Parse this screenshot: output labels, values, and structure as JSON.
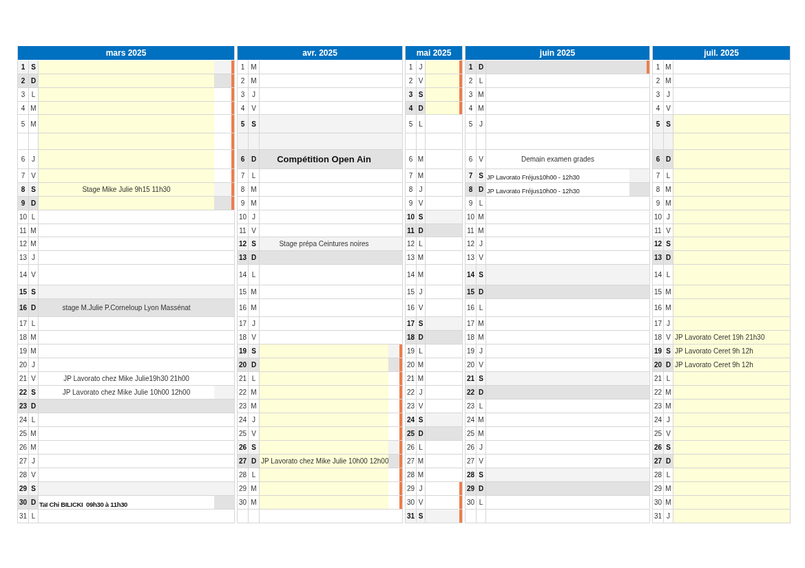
{
  "months": [
    {
      "title": "mars 2025",
      "days": [
        {
          "day": "1",
          "weekday": "S",
          "kind": "saturday",
          "highlighted": true,
          "cleared": false,
          "vacation": true
        },
        {
          "day": "2",
          "weekday": "D",
          "kind": "sunday",
          "highlighted": true,
          "cleared": false,
          "vacation": true
        },
        {
          "day": "3",
          "weekday": "L",
          "kind": "weekday",
          "highlighted": true,
          "vacation": true
        },
        {
          "day": "4",
          "weekday": "M",
          "kind": "weekday",
          "highlighted": true,
          "vacation": true
        },
        {
          "day": "5",
          "weekday": "M",
          "kind": "weekday",
          "highlighted": true,
          "vacation": true
        },
        {
          "day": "6",
          "weekday": "J",
          "kind": "weekday",
          "highlighted": true,
          "vacation": true
        },
        {
          "day": "7",
          "weekday": "V",
          "kind": "weekday",
          "highlighted": true,
          "vacation": true
        },
        {
          "day": "8",
          "weekday": "S",
          "kind": "saturday",
          "highlighted": true,
          "cleared": false,
          "vacation": true,
          "event": {
            "text": "Stage Mike Julie 9h15 11h30",
            "kind": "centered"
          }
        },
        {
          "day": "9",
          "weekday": "D",
          "kind": "sunday",
          "highlighted": true,
          "cleared": false,
          "vacation": true
        },
        {
          "day": "10",
          "weekday": "L",
          "kind": "weekday",
          "highlighted": false,
          "vacation": false
        },
        {
          "day": "11",
          "weekday": "M",
          "kind": "weekday",
          "highlighted": false,
          "vacation": false
        },
        {
          "day": "12",
          "weekday": "M",
          "kind": "weekday",
          "highlighted": false,
          "vacation": false
        },
        {
          "day": "13",
          "weekday": "J",
          "kind": "weekday",
          "highlighted": false,
          "vacation": false
        },
        {
          "day": "14",
          "weekday": "V",
          "kind": "weekday",
          "highlighted": false,
          "vacation": false
        },
        {
          "day": "15",
          "weekday": "S",
          "kind": "saturday",
          "highlighted": false,
          "cleared": false,
          "vacation": false
        },
        {
          "day": "16",
          "weekday": "D",
          "kind": "sunday",
          "highlighted": false,
          "cleared": false,
          "vacation": false,
          "event": {
            "text": "stage M.Julie P.Corneloup Lyon Massénat",
            "kind": "centered"
          }
        },
        {
          "day": "17",
          "weekday": "L",
          "kind": "weekday",
          "highlighted": false,
          "vacation": false
        },
        {
          "day": "18",
          "weekday": "M",
          "kind": "weekday",
          "highlighted": false,
          "vacation": false
        },
        {
          "day": "19",
          "weekday": "M",
          "kind": "weekday",
          "highlighted": false,
          "vacation": false
        },
        {
          "day": "20",
          "weekday": "J",
          "kind": "weekday",
          "highlighted": false,
          "vacation": false
        },
        {
          "day": "21",
          "weekday": "V",
          "kind": "weekday",
          "highlighted": false,
          "vacation": false,
          "event": {
            "text": "JP Lavorato chez Mike Julie19h30 21h00",
            "kind": "centered"
          }
        },
        {
          "day": "22",
          "weekday": "S",
          "kind": "saturday",
          "highlighted": false,
          "cleared": true,
          "vacation": false,
          "event": {
            "text": "JP Lavorato chez Mike Julie 10h00 12h00",
            "kind": "centered"
          }
        },
        {
          "day": "23",
          "weekday": "D",
          "kind": "sunday",
          "highlighted": false,
          "cleared": false,
          "vacation": false
        },
        {
          "day": "24",
          "weekday": "L",
          "kind": "weekday",
          "highlighted": false,
          "vacation": false
        },
        {
          "day": "25",
          "weekday": "M",
          "kind": "weekday",
          "highlighted": false,
          "vacation": false
        },
        {
          "day": "26",
          "weekday": "M",
          "kind": "weekday",
          "highlighted": false,
          "vacation": false
        },
        {
          "day": "27",
          "weekday": "J",
          "kind": "weekday",
          "highlighted": false,
          "vacation": false
        },
        {
          "day": "28",
          "weekday": "V",
          "kind": "weekday",
          "highlighted": false,
          "vacation": false
        },
        {
          "day": "29",
          "weekday": "S",
          "kind": "saturday",
          "highlighted": false,
          "cleared": false,
          "vacation": false
        },
        {
          "day": "30",
          "weekday": "D",
          "kind": "sunday",
          "highlighted": false,
          "cleared": true,
          "vacation": false,
          "event": {
            "text": "Taï Chi BILICKI  09h30 à 11h30",
            "kind": "note-bold"
          }
        },
        {
          "day": "31",
          "weekday": "L",
          "kind": "weekday",
          "highlighted": false,
          "vacation": false
        }
      ]
    },
    {
      "title": "avr. 2025",
      "days": [
        {
          "day": "1",
          "weekday": "M",
          "kind": "weekday",
          "highlighted": false,
          "vacation": false
        },
        {
          "day": "2",
          "weekday": "M",
          "kind": "weekday",
          "highlighted": false,
          "vacation": false
        },
        {
          "day": "3",
          "weekday": "J",
          "kind": "weekday",
          "highlighted": false,
          "vacation": false
        },
        {
          "day": "4",
          "weekday": "V",
          "kind": "weekday",
          "highlighted": false,
          "vacation": false
        },
        {
          "day": "5",
          "weekday": "S",
          "kind": "saturday",
          "highlighted": false,
          "cleared": false,
          "vacation": false
        },
        {
          "day": "6",
          "weekday": "D",
          "kind": "sunday",
          "highlighted": false,
          "cleared": false,
          "vacation": false,
          "event": {
            "text": "Compétition Open Ain",
            "kind": "headline"
          }
        },
        {
          "day": "7",
          "weekday": "L",
          "kind": "weekday",
          "highlighted": false,
          "vacation": false
        },
        {
          "day": "8",
          "weekday": "M",
          "kind": "weekday",
          "highlighted": false,
          "vacation": false
        },
        {
          "day": "9",
          "weekday": "M",
          "kind": "weekday",
          "highlighted": false,
          "vacation": false
        },
        {
          "day": "10",
          "weekday": "J",
          "kind": "weekday",
          "highlighted": false,
          "vacation": false
        },
        {
          "day": "11",
          "weekday": "V",
          "kind": "weekday",
          "highlighted": false,
          "vacation": false
        },
        {
          "day": "12",
          "weekday": "S",
          "kind": "saturday",
          "highlighted": false,
          "cleared": false,
          "vacation": false,
          "event": {
            "text": "Stage prépa Ceintures noires",
            "kind": "centered"
          }
        },
        {
          "day": "13",
          "weekday": "D",
          "kind": "sunday",
          "highlighted": false,
          "cleared": false,
          "vacation": false
        },
        {
          "day": "14",
          "weekday": "L",
          "kind": "weekday",
          "highlighted": false,
          "vacation": false
        },
        {
          "day": "15",
          "weekday": "M",
          "kind": "weekday",
          "highlighted": false,
          "vacation": false
        },
        {
          "day": "16",
          "weekday": "M",
          "kind": "weekday",
          "highlighted": false,
          "vacation": false
        },
        {
          "day": "17",
          "weekday": "J",
          "kind": "weekday",
          "highlighted": false,
          "vacation": false
        },
        {
          "day": "18",
          "weekday": "V",
          "kind": "weekday",
          "highlighted": false,
          "vacation": false
        },
        {
          "day": "19",
          "weekday": "S",
          "kind": "saturday",
          "highlighted": true,
          "cleared": false,
          "vacation": true
        },
        {
          "day": "20",
          "weekday": "D",
          "kind": "sunday",
          "highlighted": true,
          "cleared": false,
          "vacation": true
        },
        {
          "day": "21",
          "weekday": "L",
          "kind": "weekday",
          "highlighted": true,
          "vacation": true
        },
        {
          "day": "22",
          "weekday": "M",
          "kind": "weekday",
          "highlighted": true,
          "vacation": true
        },
        {
          "day": "23",
          "weekday": "M",
          "kind": "weekday",
          "highlighted": true,
          "vacation": true
        },
        {
          "day": "24",
          "weekday": "J",
          "kind": "weekday",
          "highlighted": true,
          "vacation": true
        },
        {
          "day": "25",
          "weekday": "V",
          "kind": "weekday",
          "highlighted": true,
          "vacation": true
        },
        {
          "day": "26",
          "weekday": "S",
          "kind": "saturday",
          "highlighted": true,
          "cleared": false,
          "vacation": true
        },
        {
          "day": "27",
          "weekday": "D",
          "kind": "sunday",
          "highlighted": true,
          "cleared": false,
          "vacation": true,
          "event": {
            "text": "JP Lavorato chez Mike Julie 10h00 12h00",
            "kind": "left"
          }
        },
        {
          "day": "28",
          "weekday": "L",
          "kind": "weekday",
          "highlighted": true,
          "vacation": true
        },
        {
          "day": "29",
          "weekday": "M",
          "kind": "weekday",
          "highlighted": true,
          "vacation": true
        },
        {
          "day": "30",
          "weekday": "M",
          "kind": "weekday",
          "highlighted": true,
          "vacation": true
        }
      ]
    },
    {
      "title": "mai 2025",
      "days": [
        {
          "day": "1",
          "weekday": "J",
          "kind": "weekday",
          "highlighted": true,
          "vacation": true
        },
        {
          "day": "2",
          "weekday": "V",
          "kind": "weekday",
          "highlighted": true,
          "vacation": true
        },
        {
          "day": "3",
          "weekday": "S",
          "kind": "saturday",
          "highlighted": true,
          "cleared": false,
          "vacation": true
        },
        {
          "day": "4",
          "weekday": "D",
          "kind": "sunday",
          "highlighted": true,
          "cleared": false,
          "vacation": true
        },
        {
          "day": "5",
          "weekday": "L",
          "kind": "weekday",
          "highlighted": false,
          "vacation": false
        },
        {
          "day": "6",
          "weekday": "M",
          "kind": "weekday",
          "highlighted": false,
          "vacation": false
        },
        {
          "day": "7",
          "weekday": "M",
          "kind": "weekday",
          "highlighted": false,
          "vacation": false
        },
        {
          "day": "8",
          "weekday": "J",
          "kind": "weekday",
          "highlighted": false,
          "vacation": false
        },
        {
          "day": "9",
          "weekday": "V",
          "kind": "weekday",
          "highlighted": false,
          "vacation": false
        },
        {
          "day": "10",
          "weekday": "S",
          "kind": "saturday",
          "highlighted": false,
          "cleared": false,
          "vacation": false
        },
        {
          "day": "11",
          "weekday": "D",
          "kind": "sunday",
          "highlighted": false,
          "cleared": false,
          "vacation": false
        },
        {
          "day": "12",
          "weekday": "L",
          "kind": "weekday",
          "highlighted": false,
          "vacation": false
        },
        {
          "day": "13",
          "weekday": "M",
          "kind": "weekday",
          "highlighted": false,
          "vacation": false
        },
        {
          "day": "14",
          "weekday": "M",
          "kind": "weekday",
          "highlighted": false,
          "vacation": false
        },
        {
          "day": "15",
          "weekday": "J",
          "kind": "weekday",
          "highlighted": false,
          "vacation": false
        },
        {
          "day": "16",
          "weekday": "V",
          "kind": "weekday",
          "highlighted": false,
          "vacation": false
        },
        {
          "day": "17",
          "weekday": "S",
          "kind": "saturday",
          "highlighted": false,
          "cleared": false,
          "vacation": false
        },
        {
          "day": "18",
          "weekday": "D",
          "kind": "sunday",
          "highlighted": false,
          "cleared": false,
          "vacation": false
        },
        {
          "day": "19",
          "weekday": "L",
          "kind": "weekday",
          "highlighted": false,
          "vacation": false
        },
        {
          "day": "20",
          "weekday": "M",
          "kind": "weekday",
          "highlighted": false,
          "vacation": false
        },
        {
          "day": "21",
          "weekday": "M",
          "kind": "weekday",
          "highlighted": false,
          "vacation": false
        },
        {
          "day": "22",
          "weekday": "J",
          "kind": "weekday",
          "highlighted": false,
          "vacation": false
        },
        {
          "day": "23",
          "weekday": "V",
          "kind": "weekday",
          "highlighted": false,
          "vacation": false
        },
        {
          "day": "24",
          "weekday": "S",
          "kind": "saturday",
          "highlighted": false,
          "cleared": false,
          "vacation": false
        },
        {
          "day": "25",
          "weekday": "D",
          "kind": "sunday",
          "highlighted": false,
          "cleared": false,
          "vacation": false
        },
        {
          "day": "26",
          "weekday": "L",
          "kind": "weekday",
          "highlighted": false,
          "vacation": false
        },
        {
          "day": "27",
          "weekday": "M",
          "kind": "weekday",
          "highlighted": false,
          "vacation": false
        },
        {
          "day": "28",
          "weekday": "M",
          "kind": "weekday",
          "highlighted": false,
          "vacation": false
        },
        {
          "day": "29",
          "weekday": "J",
          "kind": "weekday",
          "highlighted": false,
          "vacation": true
        },
        {
          "day": "30",
          "weekday": "V",
          "kind": "weekday",
          "highlighted": false,
          "vacation": true
        },
        {
          "day": "31",
          "weekday": "S",
          "kind": "saturday",
          "highlighted": false,
          "cleared": false,
          "vacation": true
        }
      ]
    },
    {
      "title": "juin 2025",
      "days": [
        {
          "day": "1",
          "weekday": "D",
          "kind": "sunday",
          "highlighted": false,
          "cleared": false,
          "vacation": true
        },
        {
          "day": "2",
          "weekday": "L",
          "kind": "weekday",
          "highlighted": false,
          "vacation": false
        },
        {
          "day": "3",
          "weekday": "M",
          "kind": "weekday",
          "highlighted": false,
          "vacation": false
        },
        {
          "day": "4",
          "weekday": "M",
          "kind": "weekday",
          "highlighted": false,
          "vacation": false
        },
        {
          "day": "5",
          "weekday": "J",
          "kind": "weekday",
          "highlighted": false,
          "vacation": false
        },
        {
          "day": "6",
          "weekday": "V",
          "kind": "weekday",
          "highlighted": false,
          "vacation": false,
          "event": {
            "text": "Demain examen grades",
            "kind": "centered"
          }
        },
        {
          "day": "7",
          "weekday": "S",
          "kind": "saturday",
          "highlighted": false,
          "cleared": true,
          "vacation": false,
          "event": {
            "text": "JP Lavorato Fréjus10h00 - 12h30",
            "kind": "note"
          }
        },
        {
          "day": "8",
          "weekday": "D",
          "kind": "sunday",
          "highlighted": false,
          "cleared": true,
          "vacation": false,
          "event": {
            "text": "JP Lavorato Fréjus10h00 - 12h30",
            "kind": "note"
          }
        },
        {
          "day": "9",
          "weekday": "L",
          "kind": "weekday",
          "highlighted": false,
          "vacation": false
        },
        {
          "day": "10",
          "weekday": "M",
          "kind": "weekday",
          "highlighted": false,
          "vacation": false
        },
        {
          "day": "11",
          "weekday": "M",
          "kind": "weekday",
          "highlighted": false,
          "vacation": false
        },
        {
          "day": "12",
          "weekday": "J",
          "kind": "weekday",
          "highlighted": false,
          "vacation": false
        },
        {
          "day": "13",
          "weekday": "V",
          "kind": "weekday",
          "highlighted": false,
          "vacation": false
        },
        {
          "day": "14",
          "weekday": "S",
          "kind": "saturday",
          "highlighted": false,
          "cleared": false,
          "vacation": false
        },
        {
          "day": "15",
          "weekday": "D",
          "kind": "sunday",
          "highlighted": false,
          "cleared": false,
          "vacation": false
        },
        {
          "day": "16",
          "weekday": "L",
          "kind": "weekday",
          "highlighted": false,
          "vacation": false
        },
        {
          "day": "17",
          "weekday": "M",
          "kind": "weekday",
          "highlighted": false,
          "vacation": false
        },
        {
          "day": "18",
          "weekday": "M",
          "kind": "weekday",
          "highlighted": false,
          "vacation": false
        },
        {
          "day": "19",
          "weekday": "J",
          "kind": "weekday",
          "highlighted": false,
          "vacation": false
        },
        {
          "day": "20",
          "weekday": "V",
          "kind": "weekday",
          "highlighted": false,
          "vacation": false
        },
        {
          "day": "21",
          "weekday": "S",
          "kind": "saturday",
          "highlighted": false,
          "cleared": false,
          "vacation": false
        },
        {
          "day": "22",
          "weekday": "D",
          "kind": "sunday",
          "highlighted": false,
          "cleared": false,
          "vacation": false
        },
        {
          "day": "23",
          "weekday": "L",
          "kind": "weekday",
          "highlighted": false,
          "vacation": false
        },
        {
          "day": "24",
          "weekday": "M",
          "kind": "weekday",
          "highlighted": false,
          "vacation": false
        },
        {
          "day": "25",
          "weekday": "M",
          "kind": "weekday",
          "highlighted": false,
          "vacation": false
        },
        {
          "day": "26",
          "weekday": "J",
          "kind": "weekday",
          "highlighted": false,
          "vacation": false
        },
        {
          "day": "27",
          "weekday": "V",
          "kind": "weekday",
          "highlighted": false,
          "vacation": false
        },
        {
          "day": "28",
          "weekday": "S",
          "kind": "saturday",
          "highlighted": false,
          "cleared": false,
          "vacation": false
        },
        {
          "day": "29",
          "weekday": "D",
          "kind": "sunday",
          "highlighted": false,
          "cleared": false,
          "vacation": false
        },
        {
          "day": "30",
          "weekday": "L",
          "kind": "weekday",
          "highlighted": false,
          "vacation": false
        }
      ]
    },
    {
      "title": "juil. 2025",
      "days": [
        {
          "day": "1",
          "weekday": "M",
          "kind": "weekday",
          "highlighted": false,
          "vacation": false
        },
        {
          "day": "2",
          "weekday": "M",
          "kind": "weekday",
          "highlighted": false,
          "vacation": false
        },
        {
          "day": "3",
          "weekday": "J",
          "kind": "weekday",
          "highlighted": false,
          "vacation": false
        },
        {
          "day": "4",
          "weekday": "V",
          "kind": "weekday",
          "highlighted": false,
          "vacation": false
        },
        {
          "day": "5",
          "weekday": "S",
          "kind": "saturday",
          "highlighted": true,
          "cleared": false,
          "vacation": false
        },
        {
          "day": "6",
          "weekday": "D",
          "kind": "sunday",
          "highlighted": true,
          "cleared": false,
          "vacation": false
        },
        {
          "day": "7",
          "weekday": "L",
          "kind": "weekday",
          "highlighted": true,
          "vacation": false
        },
        {
          "day": "8",
          "weekday": "M",
          "kind": "weekday",
          "highlighted": true,
          "vacation": false
        },
        {
          "day": "9",
          "weekday": "M",
          "kind": "weekday",
          "highlighted": true,
          "vacation": false
        },
        {
          "day": "10",
          "weekday": "J",
          "kind": "weekday",
          "highlighted": true,
          "vacation": false
        },
        {
          "day": "11",
          "weekday": "V",
          "kind": "weekday",
          "highlighted": true,
          "vacation": false
        },
        {
          "day": "12",
          "weekday": "S",
          "kind": "saturday",
          "highlighted": true,
          "cleared": false,
          "vacation": false
        },
        {
          "day": "13",
          "weekday": "D",
          "kind": "sunday",
          "highlighted": true,
          "cleared": false,
          "vacation": false
        },
        {
          "day": "14",
          "weekday": "L",
          "kind": "weekday",
          "highlighted": true,
          "vacation": false
        },
        {
          "day": "15",
          "weekday": "M",
          "kind": "weekday",
          "highlighted": true,
          "vacation": false
        },
        {
          "day": "16",
          "weekday": "M",
          "kind": "weekday",
          "highlighted": true,
          "vacation": false
        },
        {
          "day": "17",
          "weekday": "J",
          "kind": "weekday",
          "highlighted": true,
          "vacation": false
        },
        {
          "day": "18",
          "weekday": "V",
          "kind": "weekday",
          "highlighted": true,
          "vacation": false,
          "event": {
            "text": "JP Lavorato Ceret 19h 21h30",
            "kind": "left"
          }
        },
        {
          "day": "19",
          "weekday": "S",
          "kind": "saturday",
          "highlighted": true,
          "cleared": false,
          "vacation": false,
          "event": {
            "text": "JP Lavorato Ceret 9h 12h",
            "kind": "left"
          }
        },
        {
          "day": "20",
          "weekday": "D",
          "kind": "sunday",
          "highlighted": true,
          "cleared": false,
          "vacation": false,
          "event": {
            "text": "JP Lavorato Ceret 9h 12h",
            "kind": "left"
          }
        },
        {
          "day": "21",
          "weekday": "L",
          "kind": "weekday",
          "highlighted": true,
          "vacation": false
        },
        {
          "day": "22",
          "weekday": "M",
          "kind": "weekday",
          "highlighted": true,
          "vacation": false
        },
        {
          "day": "23",
          "weekday": "M",
          "kind": "weekday",
          "highlighted": true,
          "vacation": false
        },
        {
          "day": "24",
          "weekday": "J",
          "kind": "weekday",
          "highlighted": true,
          "vacation": false
        },
        {
          "day": "25",
          "weekday": "V",
          "kind": "weekday",
          "highlighted": true,
          "vacation": false
        },
        {
          "day": "26",
          "weekday": "S",
          "kind": "saturday",
          "highlighted": true,
          "cleared": false,
          "vacation": false
        },
        {
          "day": "27",
          "weekday": "D",
          "kind": "sunday",
          "highlighted": true,
          "cleared": false,
          "vacation": false
        },
        {
          "day": "28",
          "weekday": "L",
          "kind": "weekday",
          "highlighted": true,
          "vacation": false
        },
        {
          "day": "29",
          "weekday": "M",
          "kind": "weekday",
          "highlighted": true,
          "vacation": false
        },
        {
          "day": "30",
          "weekday": "M",
          "kind": "weekday",
          "highlighted": true,
          "vacation": false
        },
        {
          "day": "31",
          "weekday": "J",
          "kind": "weekday",
          "highlighted": true,
          "vacation": false
        }
      ]
    }
  ]
}
